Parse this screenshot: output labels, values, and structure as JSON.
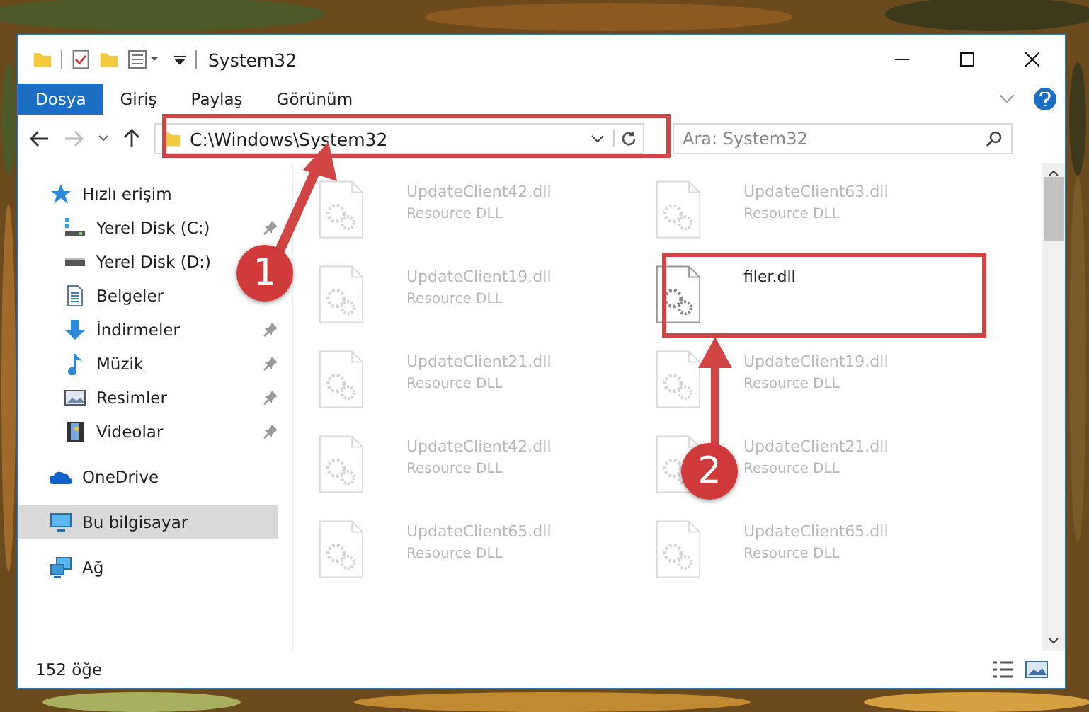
{
  "window": {
    "title": "System32"
  },
  "ribbon_tabs": [
    {
      "label": "Dosya",
      "selected": true
    },
    {
      "label": "Giriş",
      "selected": false
    },
    {
      "label": "Paylaş",
      "selected": false
    },
    {
      "label": "Görünüm",
      "selected": false
    }
  ],
  "address": {
    "path": "C:\\Windows\\System32"
  },
  "search": {
    "placeholder": "Ara: System32"
  },
  "sidebar": {
    "items": [
      {
        "label": "Hızlı erişim",
        "kind": "star",
        "selected": false,
        "children": [
          {
            "label": "Yerel Disk (C:)",
            "kind": "drive_c",
            "pinned": true,
            "selected": false
          },
          {
            "label": "Yerel Disk (D:)",
            "kind": "drive",
            "pinned": false,
            "selected": false
          },
          {
            "label": "Belgeler",
            "kind": "docs",
            "pinned": false,
            "selected": false
          },
          {
            "label": "İndirmeler",
            "kind": "download",
            "pinned": true,
            "selected": false
          },
          {
            "label": "Müzik",
            "kind": "music",
            "pinned": true,
            "selected": false
          },
          {
            "label": "Resimler",
            "kind": "pictures",
            "pinned": true,
            "selected": false
          },
          {
            "label": "Videolar",
            "kind": "videos",
            "pinned": true,
            "selected": false
          }
        ]
      },
      {
        "label": "OneDrive",
        "kind": "cloud",
        "selected": false
      },
      {
        "label": "Bu bilgisayar",
        "kind": "pc",
        "selected": true
      },
      {
        "label": "Ağ",
        "kind": "network",
        "selected": false
      }
    ]
  },
  "files": [
    {
      "name": "UpdateClient42.dll",
      "type": "Resource DLL",
      "dimmed": true
    },
    {
      "name": "UpdateClient63.dll",
      "type": "Resource DLL",
      "dimmed": true
    },
    {
      "name": "UpdateClient19.dll",
      "type": "Resource DLL",
      "dimmed": true
    },
    {
      "name": "filer.dll",
      "dimmed": false
    },
    {
      "name": "UpdateClient21.dll",
      "type": "Resource DLL",
      "dimmed": true
    },
    {
      "name": "UpdateClient19.dll",
      "type": "Resource DLL",
      "dimmed": true
    },
    {
      "name": "UpdateClient42.dll",
      "type": "Resource DLL",
      "dimmed": true
    },
    {
      "name": "UpdateClient21.dll",
      "type": "Resource DLL",
      "dimmed": true
    },
    {
      "name": "UpdateClient65.dll",
      "type": "Resource DLL",
      "dimmed": true
    },
    {
      "name": "UpdateClient65.dll",
      "type": "Resource DLL",
      "dimmed": true
    }
  ],
  "status_bar": {
    "item_count": "152 öğe"
  },
  "annotations": [
    {
      "label": "1"
    },
    {
      "label": "2"
    }
  ]
}
